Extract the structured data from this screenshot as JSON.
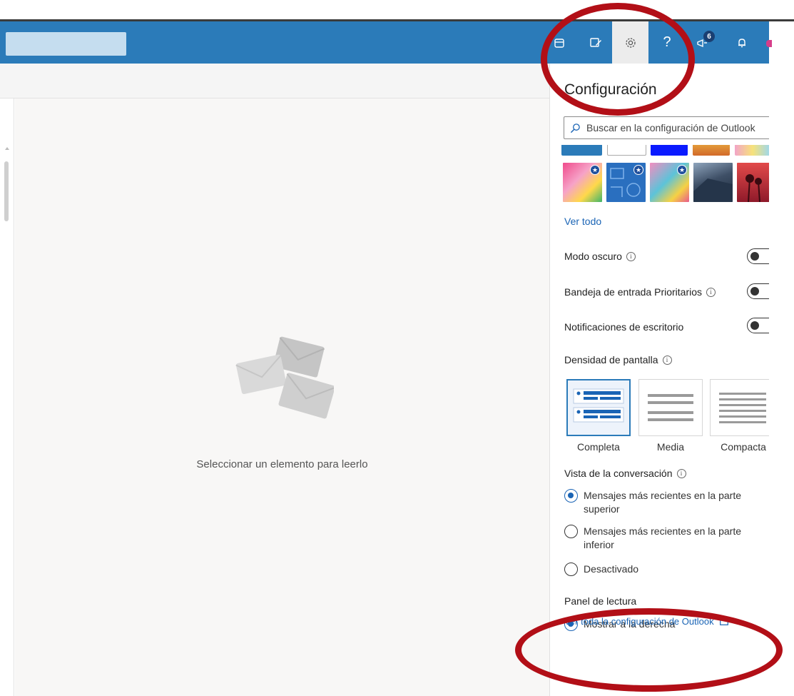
{
  "topbar": {
    "buttons": [
      {
        "name": "my-day-icon"
      },
      {
        "name": "compose-note-icon"
      },
      {
        "name": "settings-gear-icon"
      },
      {
        "name": "help-icon",
        "glyph": "?"
      },
      {
        "name": "feedback-megaphone-icon",
        "badge": "6"
      },
      {
        "name": "bell-icon"
      }
    ]
  },
  "reading_pane": {
    "empty_message": "Seleccionar un elemento para leerlo"
  },
  "settings": {
    "title": "Configuración",
    "search_placeholder": "Buscar en la configuración de Outlook",
    "see_all_themes": "Ver todo",
    "dark_mode": {
      "label": "Modo oscuro",
      "enabled": false
    },
    "focused_inbox": {
      "label": "Bandeja de entrada Prioritarios",
      "enabled": false
    },
    "desktop_notifications": {
      "label": "Notificaciones de escritorio",
      "enabled": false
    },
    "density": {
      "label": "Densidad de pantalla",
      "options": [
        "Completa",
        "Media",
        "Compacta"
      ],
      "selected": "Completa"
    },
    "conversation_view": {
      "label": "Vista de la conversación",
      "options": [
        "Mensajes más recientes en la parte superior",
        "Mensajes más recientes en la parte inferior",
        "Desactivado"
      ],
      "selected": "Mensajes más recientes en la parte superior"
    },
    "reading_pane": {
      "label": "Panel de lectura",
      "option_visible": "Mostrar a la derecha"
    },
    "view_all_settings": "Ver toda la configuración de Outlook"
  },
  "colors": {
    "accent": "#2b7bb9",
    "link": "#1a64b5",
    "annotation_ring": "#b20f17"
  }
}
